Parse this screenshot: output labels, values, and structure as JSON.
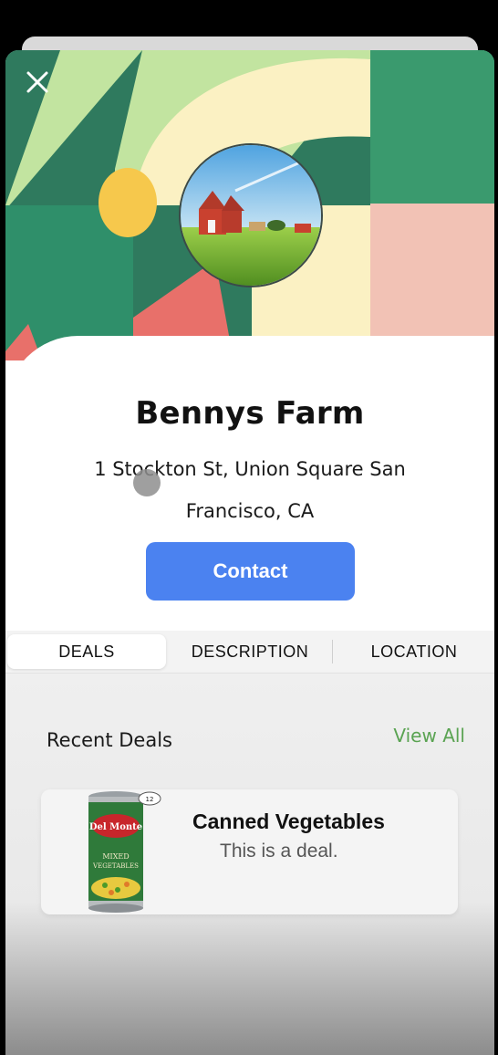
{
  "header": {
    "close_label": "Close"
  },
  "profile": {
    "name": "Bennys Farm",
    "address_line1": "1 Stockton St, Union Square San",
    "address_line2": "Francisco, CA",
    "contact_label": "Contact"
  },
  "tabs": [
    {
      "label": "DEALS",
      "active": true
    },
    {
      "label": "DESCRIPTION",
      "active": false
    },
    {
      "label": "LOCATION",
      "active": false
    }
  ],
  "deals": {
    "section_title": "Recent Deals",
    "view_all_label": "View All",
    "items": [
      {
        "title": "Canned Vegetables",
        "description": "This is a deal.",
        "image_text": [
          "Del Monte",
          "MIXED",
          "VEGETABLES",
          "12"
        ]
      }
    ]
  },
  "colors": {
    "primary_button": "#4b82f0",
    "link_green": "#5aa352",
    "banner_dark_green": "#2f7a5e",
    "banner_cream": "#fbf1c3",
    "banner_coral": "#e8706a",
    "banner_yellow": "#f6c84c"
  }
}
